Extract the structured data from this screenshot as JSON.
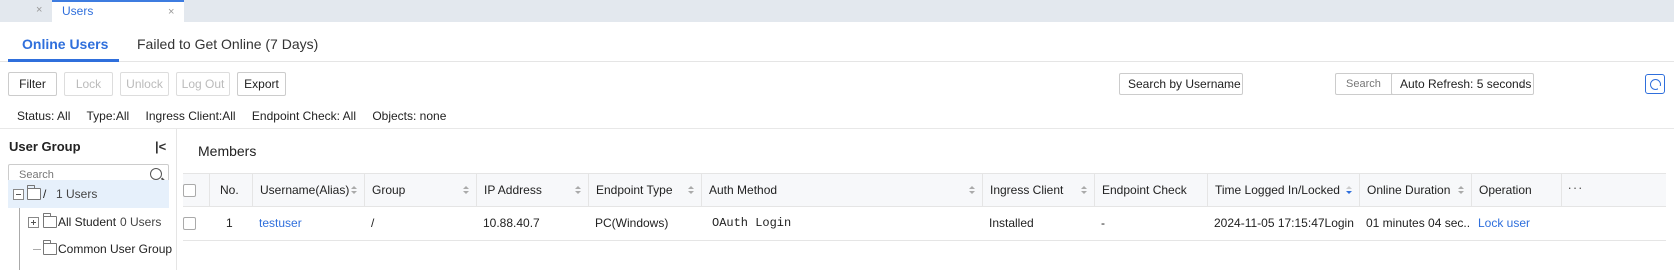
{
  "window_tabs": {
    "previous_close": "×",
    "active_label": "Users",
    "active_close": "×"
  },
  "subtabs": [
    {
      "label": "Online Users"
    },
    {
      "label": "Failed to Get Online (7 Days)"
    }
  ],
  "toolbar": {
    "filter": "Filter",
    "lock": "Lock",
    "unlock": "Unlock",
    "logout": "Log Out",
    "export": "Export",
    "search_by": "Search by Username",
    "search_placeholder": "Search",
    "auto_refresh": "Auto Refresh: 5 seconds"
  },
  "filters": {
    "status": "Status: All",
    "type": "Type:All",
    "ingress": "Ingress Client:All",
    "endpoint": "Endpoint Check: All",
    "objects": "Objects: none"
  },
  "user_group": {
    "title": "User Group",
    "collapse_glyph": "|<",
    "search_placeholder": "Search",
    "tree": [
      {
        "label": "/",
        "count": "1 Users",
        "selected": true
      },
      {
        "label": "All Student",
        "count": "0 Users"
      },
      {
        "label": "Common User Group",
        "count": ""
      }
    ]
  },
  "members": {
    "title": "Members",
    "columns": [
      "No.",
      "Username(Alias)",
      "Group",
      "IP Address",
      "Endpoint Type",
      "Auth Method",
      "Ingress Client",
      "Endpoint Check",
      "Time Logged In/Locked",
      "Online Duration",
      "Operation"
    ],
    "more_glyph": "···",
    "rows": [
      {
        "no": "1",
        "username": "testuser",
        "group": "/",
        "ip": "10.88.40.7",
        "endpoint_type": "PC(Windows)",
        "auth_method": "OAuth Login",
        "ingress": "Installed",
        "endpoint_check": "-",
        "time": "2024-11-05 17:15:47Login",
        "duration": "01 minutes 04 sec...",
        "operation": "Lock user"
      }
    ]
  },
  "colors": {
    "accent": "#2f6fdc",
    "tab_bg": "#e3e8ee",
    "selected_row": "#e6f0fb"
  }
}
